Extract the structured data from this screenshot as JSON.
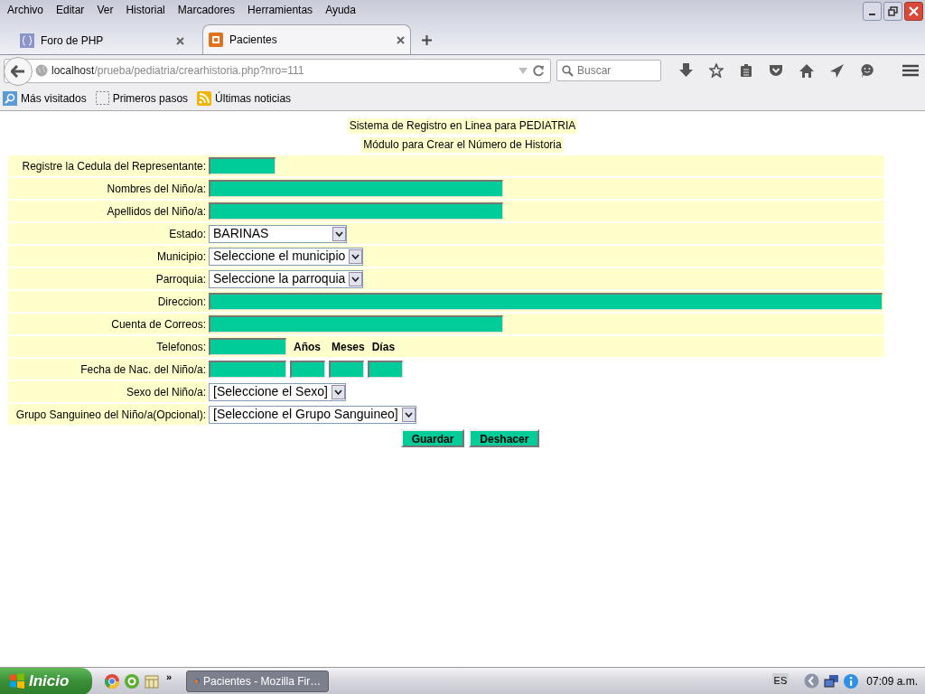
{
  "menu_bar": [
    "Archivo",
    "Editar",
    "Ver",
    "Historial",
    "Marcadores",
    "Herramientas",
    "Ayuda"
  ],
  "tabs": [
    {
      "label": "Foro de PHP",
      "selected": false
    },
    {
      "label": "Pacientes",
      "selected": true
    }
  ],
  "address_bar": {
    "host": "localhost",
    "path": "/prueba/pediatria/crearhistoria.php?nro=111"
  },
  "search": {
    "placeholder": "Buscar"
  },
  "bookmarks": [
    "Más visitados",
    "Primeros pasos",
    "Últimas noticias"
  ],
  "page": {
    "title": "Sistema de Registro en Linea para PEDIATRIA",
    "subtitle": "Módulo para Crear el Número de Historia",
    "fields": [
      {
        "label": "Registre la Cedula del Representante:",
        "kind": "short",
        "shaded": true
      },
      {
        "label": "Nombres del Niño/a:",
        "kind": "long",
        "shaded": true
      },
      {
        "label": "Apellidos del Niño/a:",
        "kind": "long",
        "shaded": true
      },
      {
        "label": "Estado:",
        "kind": "select",
        "value": "BARINAS",
        "shaded": true
      },
      {
        "label": "Municipio:",
        "kind": "select",
        "value": "Seleccione el municipio",
        "shaded": true
      },
      {
        "label": "Parroquia:",
        "kind": "select",
        "value": "Seleccione la parroquia",
        "shaded": true
      },
      {
        "label": "Direccion:",
        "kind": "full",
        "shaded": true
      },
      {
        "label": "Cuenta de Correos:",
        "kind": "long",
        "shaded": true
      },
      {
        "label": "Telefonos:",
        "kind": "phone",
        "headings": [
          "Años",
          "Meses",
          "Días"
        ],
        "shaded": true
      },
      {
        "label": "Fecha de Nac. del Niño/a:",
        "kind": "date",
        "shaded": false
      },
      {
        "label": "Sexo del Niño/a:",
        "kind": "select",
        "value": "[Seleccione el Sexo]",
        "shaded": false
      },
      {
        "label": "Grupo Sanguineo del Niño/a(Opcional):",
        "kind": "select",
        "value": "[Seleccione el Grupo Sanguineo]",
        "shaded": false
      }
    ],
    "buttons": [
      "Guardar",
      "Deshacer"
    ]
  },
  "taskbar": {
    "start": "Inicio",
    "more": "»",
    "task": "Pacientes - Mozilla Fir…",
    "language": "ES",
    "clock": "07:09 a.m."
  }
}
